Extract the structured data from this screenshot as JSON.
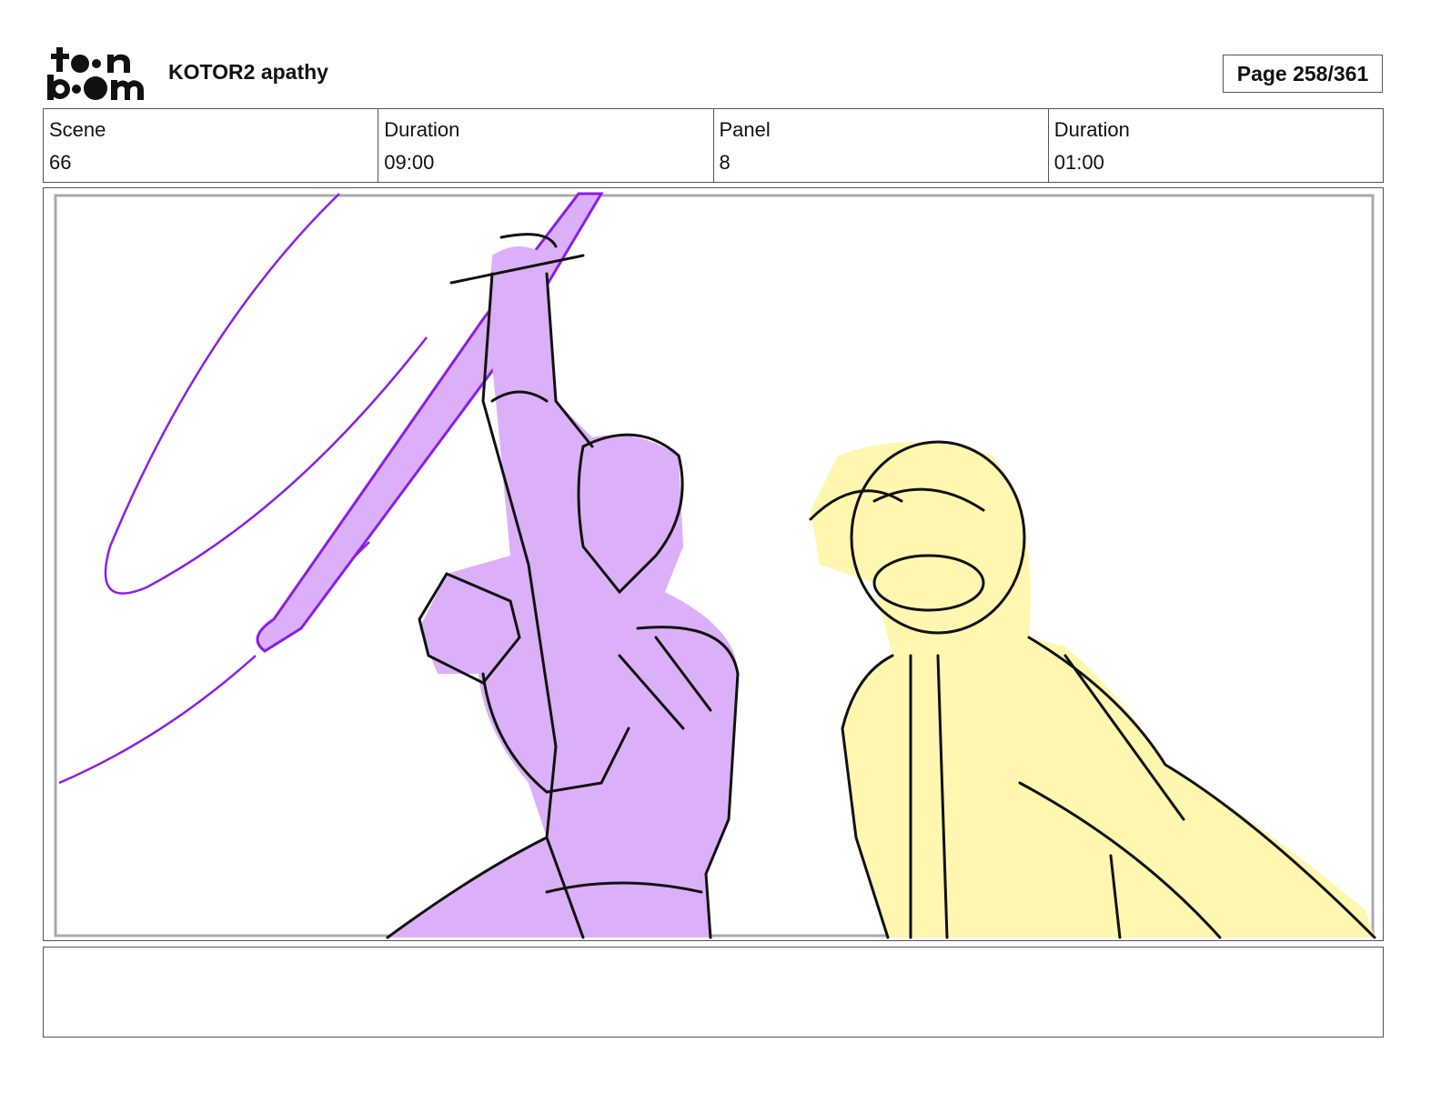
{
  "header": {
    "logo_text": "toon boom",
    "project_title": "KOTOR2 apathy",
    "page_label": "Page 258/361"
  },
  "info": {
    "scene_label": "Scene",
    "scene_value": "66",
    "scene_duration_label": "Duration",
    "scene_duration_value": "09:00",
    "panel_label": "Panel",
    "panel_value": "8",
    "panel_duration_label": "Duration",
    "panel_duration_value": "01:00"
  },
  "colors": {
    "purple_fill": "#dcb0f8",
    "purple_line": "#8a1ee6",
    "yellow_fill": "#fff6b0"
  },
  "notes": {}
}
